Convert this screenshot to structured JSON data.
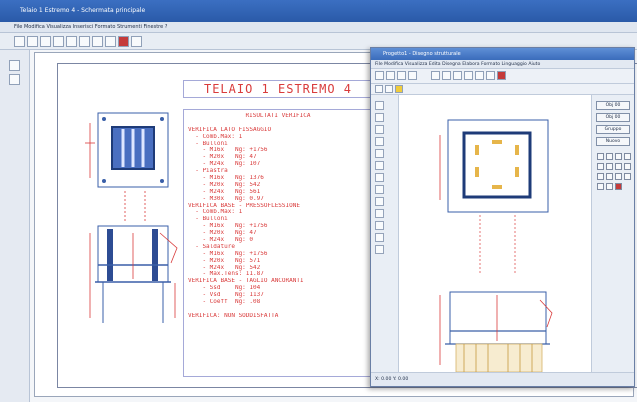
{
  "window": {
    "title": "Telaio 1 Estremo 4 - Schermata principale",
    "menu": "File  Modifica  Visualizza  Inserisci  Formato  Strumenti  Finestre  ?"
  },
  "drawing": {
    "title": "TELAIO 1 ESTREMO 4",
    "report_lines": [
      "RISULTATI VERIFICA",
      "",
      "VERIFICA LATO FISSAGGIO",
      "  - Comb.Max: 1",
      "  - Bulloni",
      "    - M16x   Ng: +1756",
      "    - M20x   Ng: 47",
      "    - M24x   Ng: 107",
      "  - Piastra",
      "    - M16x   Ng: 1376",
      "    - M20x   Ng: 542",
      "    - M24x   Ng: 561",
      "    - M30x   Ng: 0.97",
      "VERIFICA BASE - PRESSOFLESSIONE",
      "  - Comb.Max: 1",
      "  - Bulloni",
      "    - M16x   Ng: +1756",
      "    - M20x   Ng: 47",
      "    - M24x   Ng: 0",
      "  - Saldature",
      "    - M16x   Ng: +1756",
      "    - M20x   Ng: 571",
      "    - M24x   Ng: 542",
      "    - Max.Tens: 11.87",
      "VERIFICA BASE - TAGLIO ANCORANTI",
      "    - Ssd    Ng: 104",
      "    - Vsd    Ng: 1137",
      "    - Coeff  Ng: .08",
      "",
      "VERIFICA: NON SODDISFATTA"
    ]
  },
  "overlay": {
    "title": "Progetto1 - Disegno strutturale",
    "menu": "File  Modifica  Visualizza  Edita  Disegna  Elabora  Formato  Linguaggio  Aiuto",
    "right_buttons": [
      "Obj 00",
      "Obj 00",
      "Gruppo",
      "Nuovo"
    ],
    "status": "X: 0.00  Y: 0.00"
  },
  "colors": {
    "drawing_red": "#d93b3b",
    "frame_blue": "#3a5fa8",
    "column_blue": "#4a6fc0",
    "plate_yellow": "#e6b54a"
  }
}
